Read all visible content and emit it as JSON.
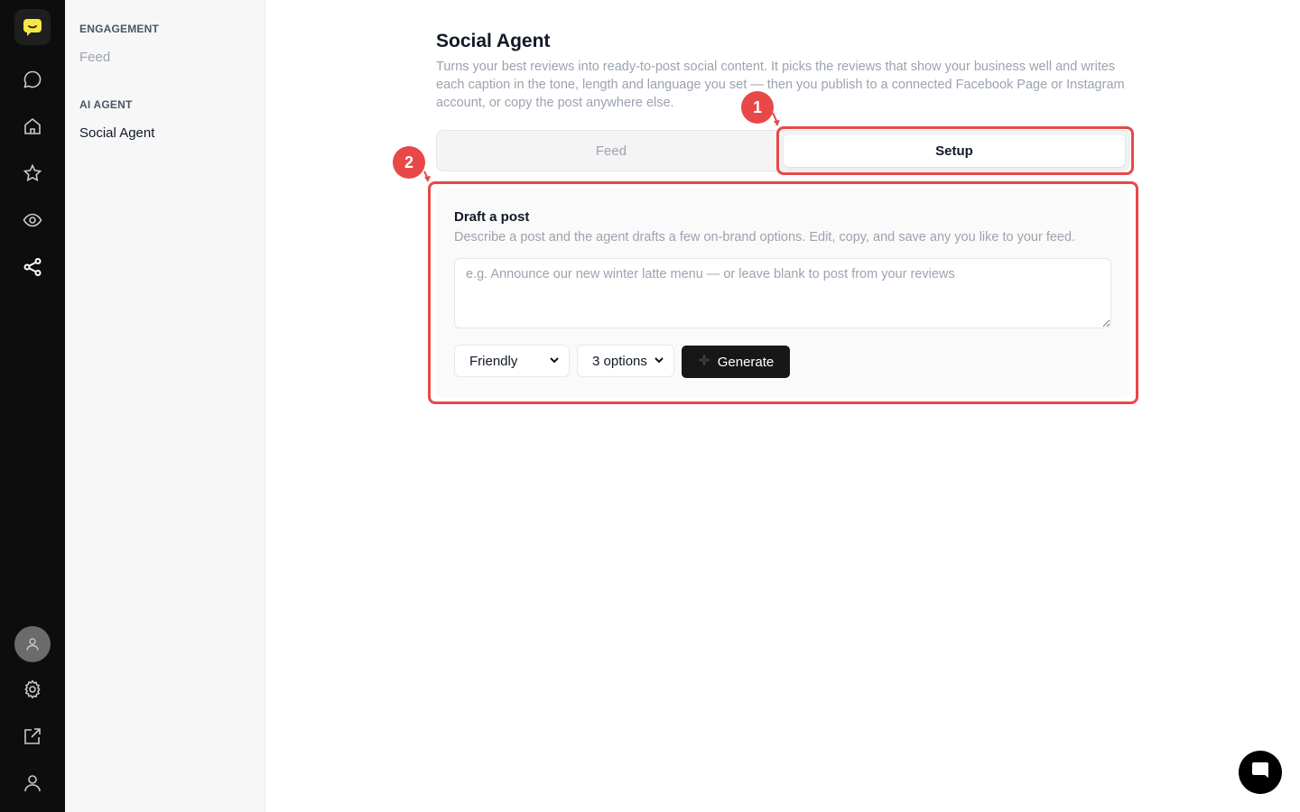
{
  "rail": {
    "icons": [
      "logo-chat-icon",
      "chat-icon",
      "home-icon",
      "star-icon",
      "eye-icon",
      "share-icon",
      "avatar-icon",
      "gear-icon",
      "external-link-icon",
      "user-icon"
    ]
  },
  "sidebar": {
    "sections": [
      {
        "label": "ENGAGEMENT",
        "items": [
          {
            "label": "Feed"
          }
        ]
      },
      {
        "label": "AI AGENT",
        "items": [
          {
            "label": "Social Agent"
          }
        ]
      }
    ]
  },
  "main": {
    "title": "Social Agent",
    "description": "Turns your best reviews into ready-to-post social content. It picks the reviews that show your business well and writes each caption in the tone, length and language you set — then you publish to a connected Facebook Page or Instagram account, or copy the post anywhere else.",
    "tabs": [
      {
        "label": "Feed"
      },
      {
        "label": "Setup"
      }
    ],
    "active_tab": "Setup",
    "draft": {
      "title": "Draft a post",
      "subtitle": "Describe a post and the agent drafts a few on-brand options. Edit, copy, and save any you like to your feed.",
      "placeholder": "e.g. Announce our new winter latte menu — or leave blank to post from your reviews",
      "value": "",
      "tone": "Friendly",
      "count": "3 options",
      "generate_label": "Generate"
    }
  },
  "annotations": [
    {
      "label": "1"
    },
    {
      "label": "2"
    }
  ],
  "colors": {
    "accent": "#e84848",
    "logo": "#f5e642",
    "rail": "#0d0d0d"
  }
}
